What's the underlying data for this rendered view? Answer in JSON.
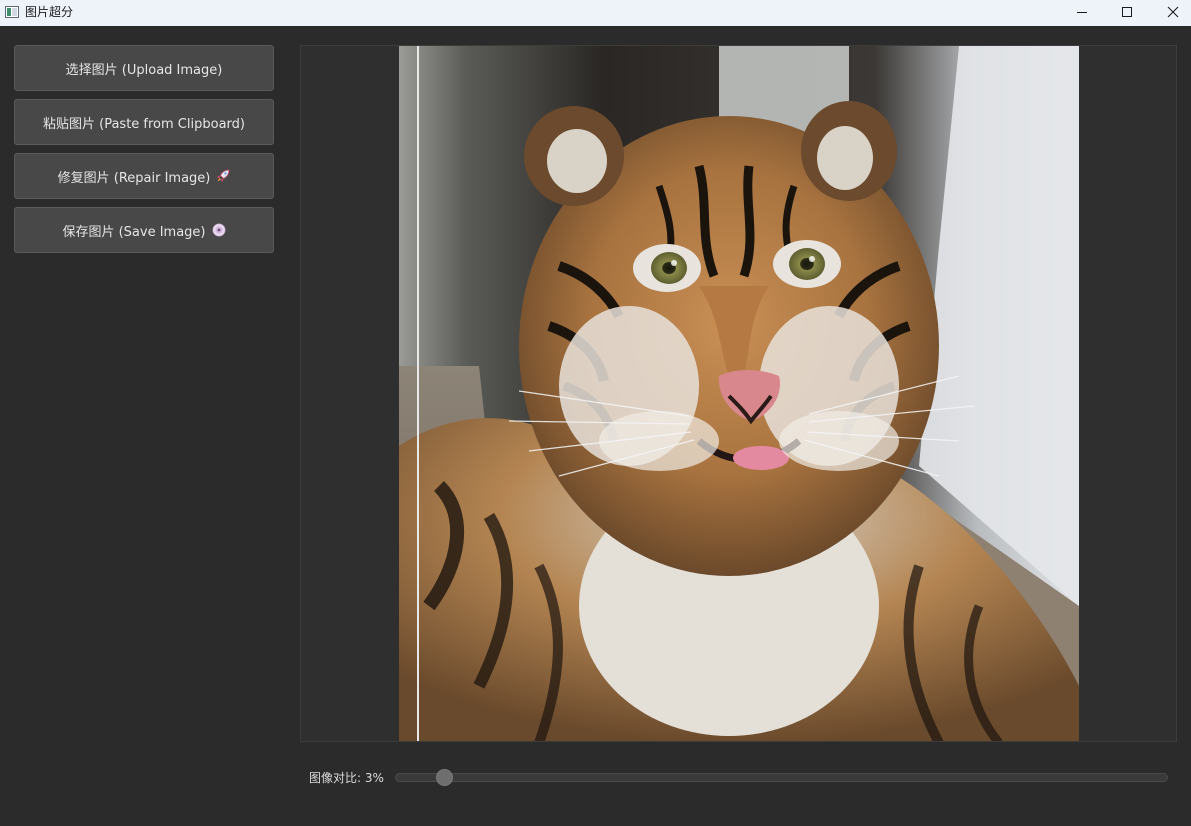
{
  "window": {
    "title": "图片超分"
  },
  "sidebar": {
    "buttons": [
      {
        "label": "选择图片 (Upload Image)",
        "icon": null
      },
      {
        "label": "粘贴图片 (Paste from Clipboard)",
        "icon": null
      },
      {
        "label": "修复图片 (Repair Image)",
        "icon": "rocket-icon"
      },
      {
        "label": "保存图片 (Save Image)",
        "icon": "disc-icon"
      }
    ]
  },
  "viewer": {
    "subject": "tiger-photo",
    "comparison_split_fraction": 0.03
  },
  "slider": {
    "label": "图像对比: 3%",
    "value_percent": 3,
    "min": 0,
    "max": 100
  },
  "colors": {
    "background": "#2b2b2b",
    "button": "#484848",
    "titlebar": "#eef2f9",
    "text": "#e6e6e6"
  }
}
